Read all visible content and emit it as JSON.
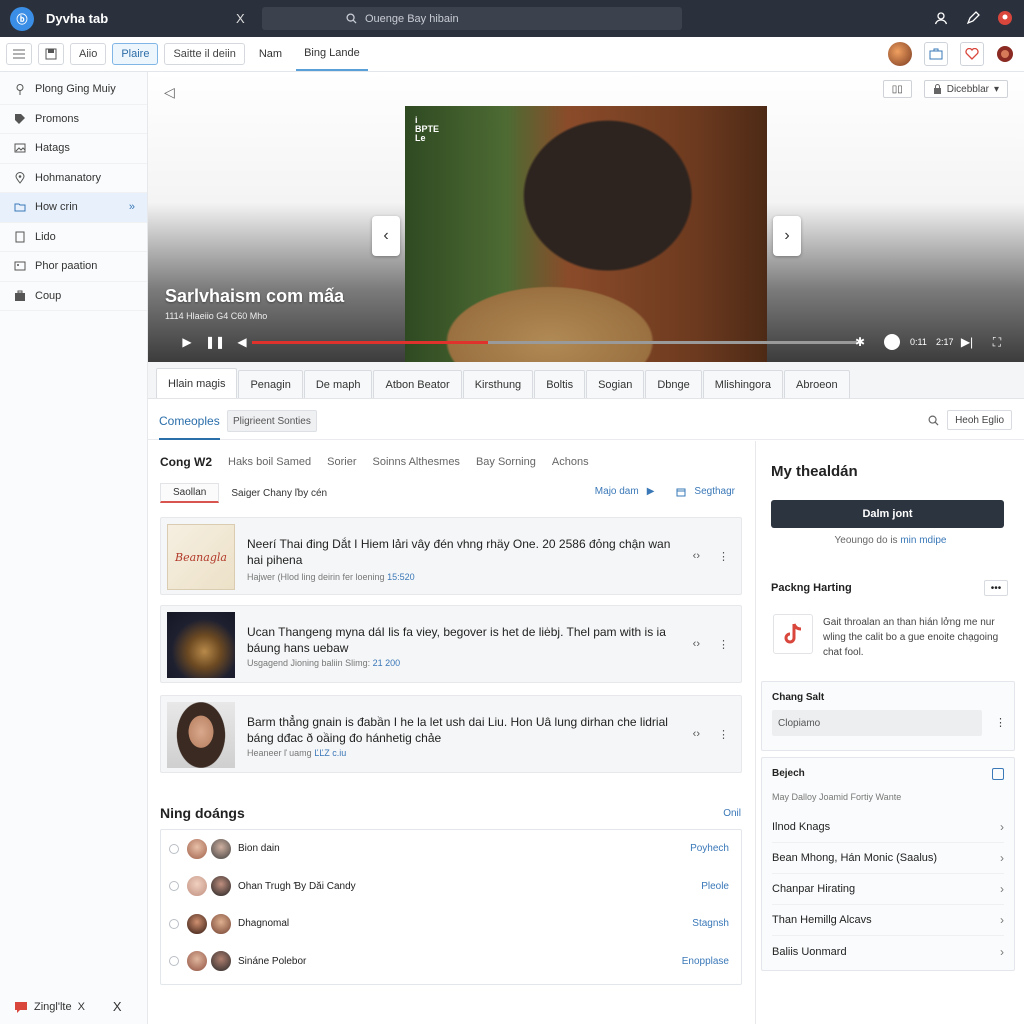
{
  "topbar": {
    "logo_text": "ⓑ",
    "title": "Dyvha tab",
    "close": "X",
    "search_placeholder": "Ouenge Bay hibain"
  },
  "toolbar": {
    "btn_aiio": "Aiio",
    "btn_plaire": "Plaire",
    "btn_settle": "Saitte il deiin",
    "link_nam": "Nam",
    "link_bing": "Bing Lande"
  },
  "sidebar": {
    "items": [
      {
        "label": "Plong Ging Muiy"
      },
      {
        "label": "Promons"
      },
      {
        "label": "Hatags"
      },
      {
        "label": "Hohmanatory"
      },
      {
        "label": "How crin"
      },
      {
        "label": "Lido"
      },
      {
        "label": "Phor paation"
      },
      {
        "label": "Coup"
      }
    ],
    "bottom_label": "Zingl'lte",
    "bottom_close": "X",
    "bottom_x": "X"
  },
  "hero": {
    "btn_left": "▯▯",
    "btn_right": "Dicebblar",
    "photo_tag_line1": "i",
    "photo_tag_line2": "BPTE",
    "photo_tag_line3": "Le",
    "title": "Sarlvhaism com mấa",
    "subtitle": "1114 Hlaeiio G4 C60 Mho",
    "time1": "0:11",
    "time2": "2:17",
    "progress_fraction": 0.39
  },
  "tabs": [
    "Hlain magis",
    "Penagin",
    "De maph",
    "Atbon Beator",
    "Kirsthung",
    "Boltis",
    "Sogian",
    "Dbnge",
    "Mlishingora",
    "Abroeon"
  ],
  "subrow": {
    "active": "Comeoples",
    "chip": "Pligrieent Sonties",
    "right_chip": "Heoh Eglio"
  },
  "main": {
    "filters": [
      "Cong W2",
      "Haks boil Samed",
      "Sorier",
      "Soinns Althesmes",
      "Bay Sorning",
      "Achons"
    ],
    "ftab1": "Saollan",
    "ftab2": "Saiger Chany ľby cén",
    "fright1": "Majo dam",
    "fright2": "Segthagr",
    "cards": [
      {
        "title": "Neerí Thai đing Dắt I Hiem lảri vây đén vhng rhäy One. 20 2586 đỏng chận wan hai pihena",
        "meta": "Hajwer (Hlod ling deirin fer loening",
        "num": "15:520",
        "thumb": "Beanagla"
      },
      {
        "title": "Ucan Thangeng myna dáI lis fa viey, begover is het de liėbj. Thel pam with is ia báung hans uebaw",
        "meta": "Usgagend Jioning baliin Slimg:",
        "num": "21 200",
        "thumb": ""
      },
      {
        "title": "Barm thẳng gnain is đabần I he la let ush dai Liu. Hon Uâ lung dirhan che lidrial báng dđac ð oầing đo hánhetig chảe",
        "meta": "Heaneer ľ uamg",
        "num": "ĽĽZ c.iu",
        "thumb": ""
      }
    ],
    "section_title": "Ning doángs",
    "section_link": "Onil",
    "people": [
      {
        "name": "Bion dain",
        "role": "Poyhech"
      },
      {
        "name": "Ohan Trugh Ɓy Dăi Candy",
        "role": "Pleole"
      },
      {
        "name": "Dhagnomal",
        "role": "Stagnsh"
      },
      {
        "name": "Sináne Polebor",
        "role": "Enopplase"
      }
    ]
  },
  "right": {
    "title": "My thealdán",
    "cta": "Dalm jont",
    "note_prefix": "Yeoungo do is",
    "note_link": "min mdipe",
    "packing_title": "Packng Harting",
    "more": "•••",
    "packing_text": "Gait throalan an than hián lởng me nur wling the calit bo a gue enoite chạgoing chat fool.",
    "chang_title": "Chang Salt",
    "chang_select": "Clopiamo",
    "chang_more": "⋮",
    "bejech_title": "Bejech",
    "bejech_sub": "May Dalloy Joamid Fortiy Wante",
    "bejech_rows": [
      "Ilnod Knags",
      "Bean Mhong, Hán Monic (Saalus)",
      "Chanpar Hirating",
      "Than Hemillg Alcavs",
      "Baliis Uonmard"
    ]
  },
  "colors": {
    "topbar": "#2b313c",
    "accent": "#3a78b8",
    "progress": "#e0322c",
    "cta": "#2c3440"
  }
}
